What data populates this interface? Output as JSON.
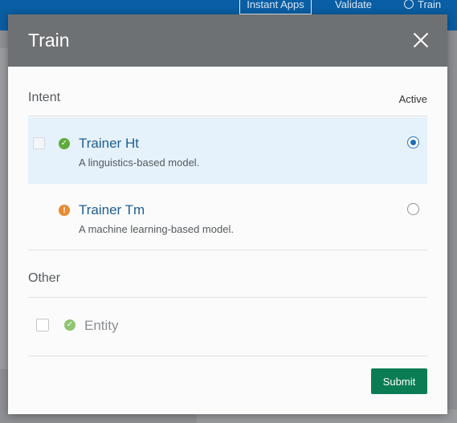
{
  "background": {
    "topbar": {
      "instant_apps": "Instant Apps",
      "validate": "Validate",
      "train": "Train"
    }
  },
  "dialog": {
    "title": "Train",
    "close_icon": "close-icon",
    "intent": {
      "section_label": "Intent",
      "active_label": "Active",
      "trainers": [
        {
          "name": "Trainer Ht",
          "description": "A linguistics-based model.",
          "status": "ok",
          "selected": true
        },
        {
          "name": "Trainer Tm",
          "description": "A machine learning-based model.",
          "status": "warning",
          "selected": false
        }
      ]
    },
    "other": {
      "section_label": "Other",
      "items": [
        {
          "label": "Entity",
          "status": "ok"
        }
      ]
    },
    "submit_label": "Submit"
  },
  "colors": {
    "header": "#6e7173",
    "accent_blue": "#1d6fb8",
    "submit_green": "#0b7d54",
    "ok_green": "#5fab3a",
    "warn_orange": "#e88a2e"
  }
}
